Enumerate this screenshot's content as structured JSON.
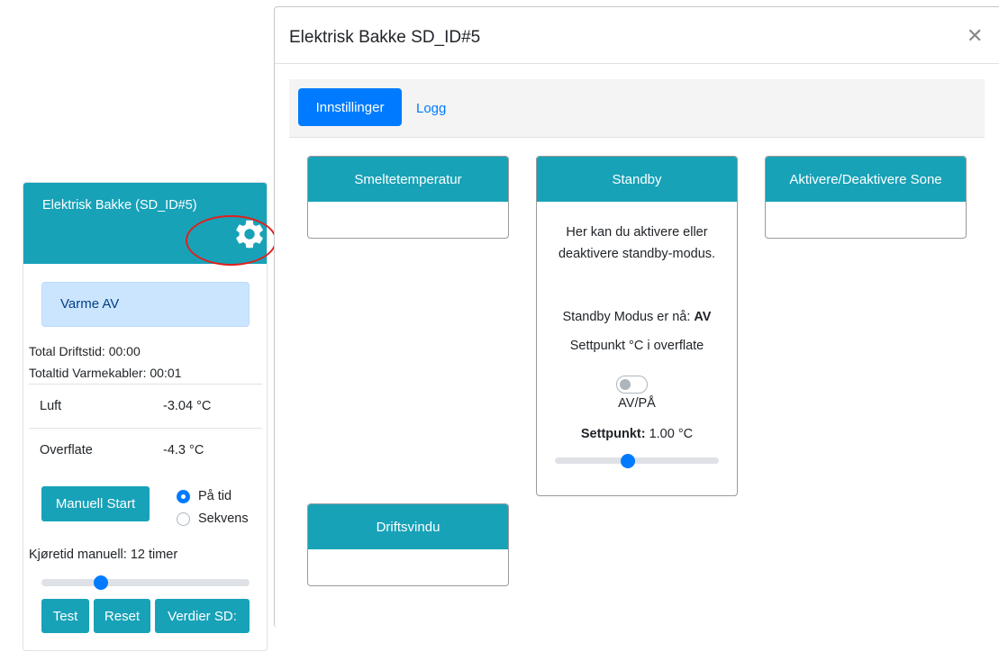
{
  "card": {
    "title": "Elektrisk Bakke (SD_ID#5)",
    "gear_icon": "gear-icon",
    "alert": "Varme AV",
    "total_driftstid": "Total Driftstid: 00:00",
    "totaltid_varmekabler": "Totaltid Varmekabler: 00:01",
    "rows": [
      {
        "label": "Luft",
        "value": "-3.04 °C"
      },
      {
        "label": "Overflate",
        "value": "-4.3 °C"
      }
    ],
    "manual_start_label": "Manuell Start",
    "radios": [
      {
        "label": "På tid",
        "checked": true
      },
      {
        "label": "Sekvens",
        "checked": false
      }
    ],
    "runtime_label": "Kjøretid manuell: 12 timer",
    "runtime_slider_fraction": 0.27,
    "buttons": [
      "Test",
      "Reset",
      "Verdier SD:"
    ],
    "accent": "#17a2b8"
  },
  "modal": {
    "title": "Elektrisk Bakke SD_ID#5",
    "close_icon": "close-icon",
    "tabs": [
      {
        "label": "Innstillinger",
        "active": true
      },
      {
        "label": "Logg",
        "active": false
      }
    ],
    "panels": {
      "smeltetemperatur": {
        "title": "Smeltetemperatur"
      },
      "standby": {
        "title": "Standby",
        "description": "Her kan du aktivere eller deaktivere standby-modus.",
        "status_prefix": "Standby Modus er nå: ",
        "status_value": "AV",
        "settpunkt_caption": "Settpunkt °C i overflate",
        "toggle_label": "AV/PÅ",
        "toggle_on": false,
        "settpunkt_label": "Settpunkt:",
        "settpunkt_value": " 1.00 °C",
        "slider_fraction": 0.44
      },
      "aktivere": {
        "title": "Aktivere/Deaktivere Sone"
      },
      "driftsvindu": {
        "title": "Driftsvindu"
      }
    },
    "primary_color": "#007bff"
  }
}
